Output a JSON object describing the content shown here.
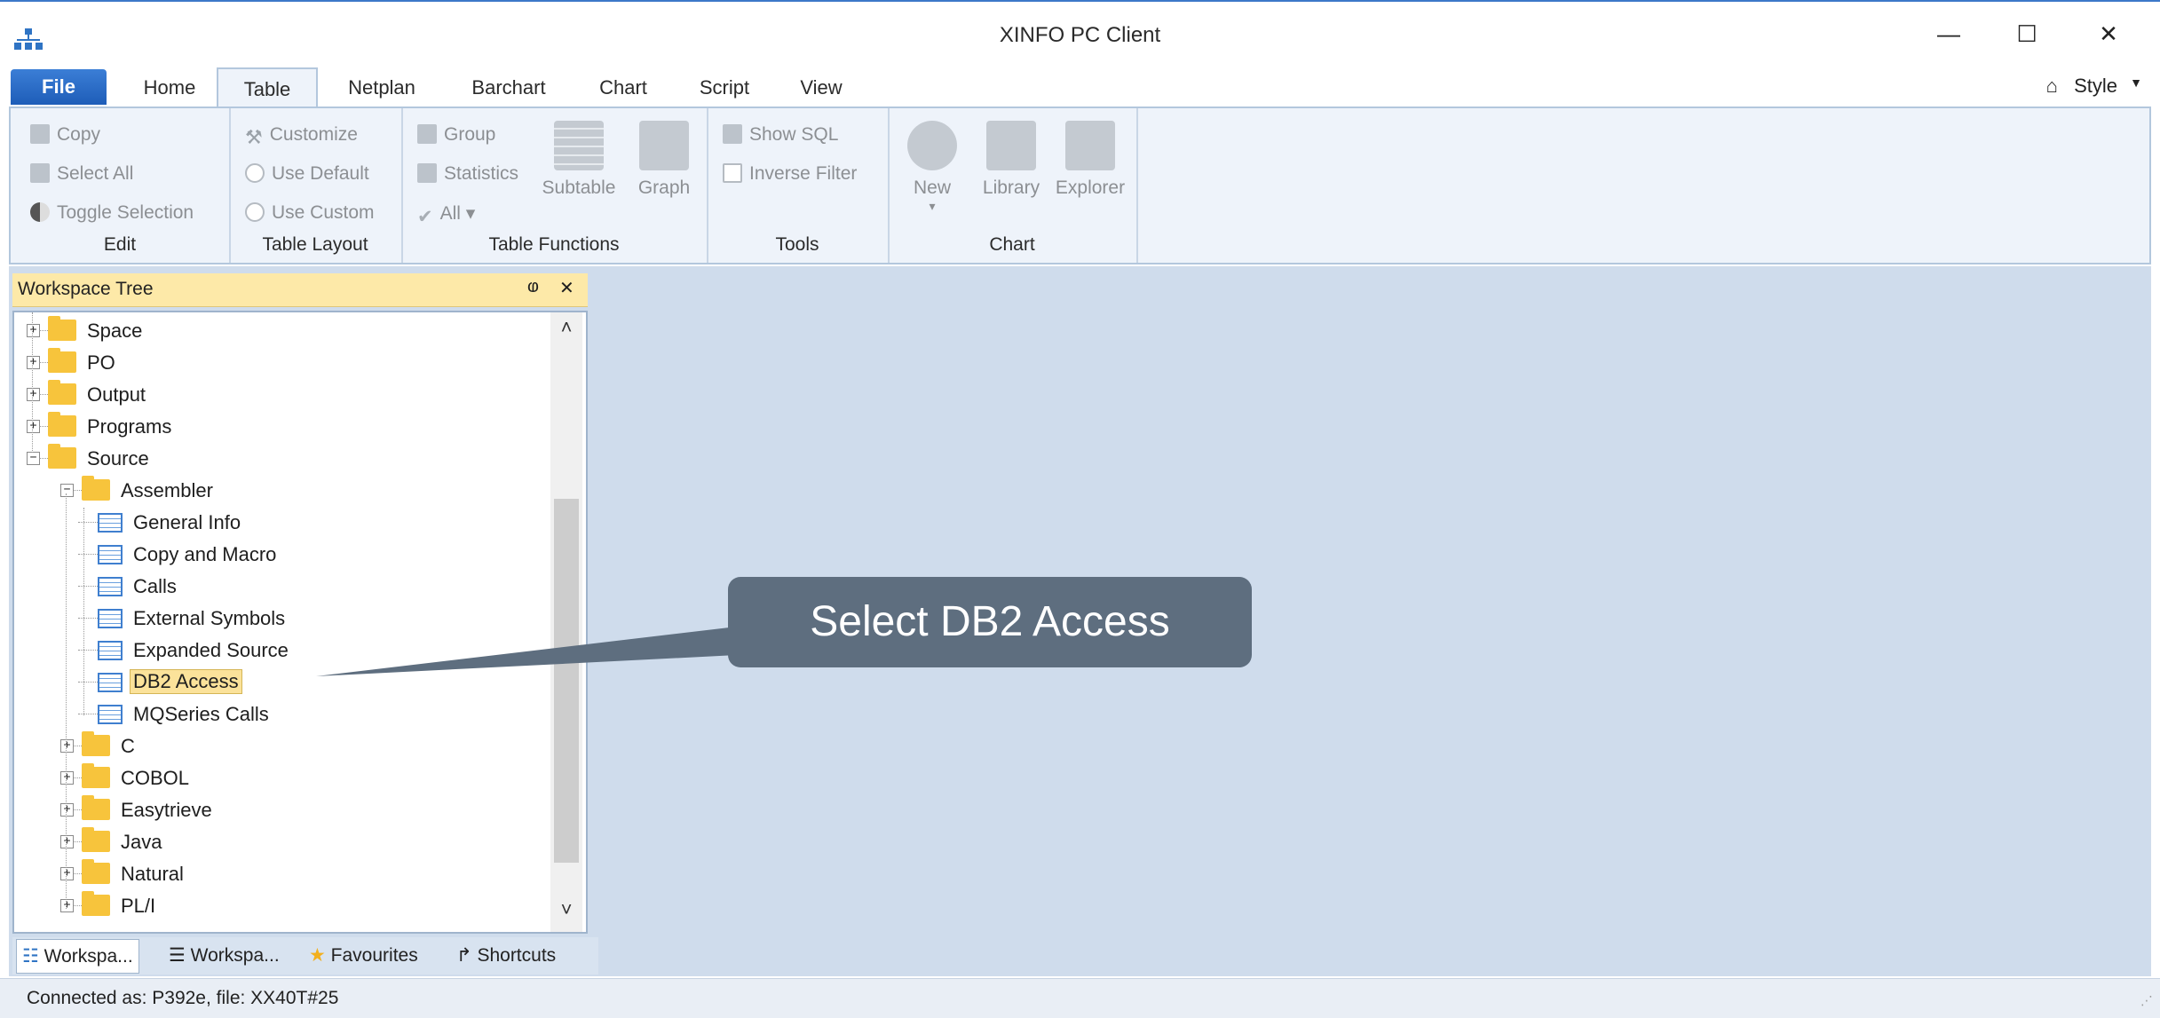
{
  "window": {
    "title": "XINFO PC Client",
    "minimize": "—",
    "maximize": "☐",
    "close": "✕"
  },
  "tabs": [
    "File",
    "Home",
    "Table",
    "Netplan",
    "Barchart",
    "Chart",
    "Script",
    "View"
  ],
  "style_label": "Style",
  "ribbon": {
    "edit": {
      "label": "Edit",
      "copy": "Copy",
      "select_all": "Select All",
      "toggle": "Toggle Selection"
    },
    "layout": {
      "label": "Table Layout",
      "customize": "Customize",
      "use_default": "Use Default",
      "use_custom": "Use Custom"
    },
    "functions": {
      "label": "Table Functions",
      "group": "Group",
      "statistics": "Statistics",
      "all": "All ▾",
      "subtable": "Subtable",
      "graph": "Graph"
    },
    "tools": {
      "label": "Tools",
      "show_sql": "Show SQL",
      "inverse_filter": "Inverse Filter"
    },
    "chart": {
      "label": "Chart",
      "new": "New",
      "new_arrow": "▾",
      "library": "Library",
      "explorer": "Explorer"
    }
  },
  "panel": {
    "title": "Workspace Tree",
    "pin": "ⱷ",
    "close": "✕"
  },
  "tree": [
    {
      "label": "Space",
      "type": "folder",
      "level": 0,
      "exp": "+"
    },
    {
      "label": "PO",
      "type": "folder",
      "level": 0,
      "exp": "+"
    },
    {
      "label": "Output",
      "type": "folder",
      "level": 0,
      "exp": "+"
    },
    {
      "label": "Programs",
      "type": "folder",
      "level": 0,
      "exp": "+"
    },
    {
      "label": "Source",
      "type": "folder",
      "level": 0,
      "exp": "−"
    },
    {
      "label": "Assembler",
      "type": "folder",
      "level": 1,
      "exp": "−"
    },
    {
      "label": "General Info",
      "type": "table",
      "level": 2
    },
    {
      "label": "Copy and Macro",
      "type": "table",
      "level": 2
    },
    {
      "label": "Calls",
      "type": "table",
      "level": 2
    },
    {
      "label": "External Symbols",
      "type": "table",
      "level": 2
    },
    {
      "label": "Expanded Source",
      "type": "table",
      "level": 2
    },
    {
      "label": "DB2 Access",
      "type": "table",
      "level": 2,
      "selected": true
    },
    {
      "label": "MQSeries Calls",
      "type": "table",
      "level": 2
    },
    {
      "label": "C",
      "type": "folder",
      "level": 1,
      "exp": "+"
    },
    {
      "label": "COBOL",
      "type": "folder",
      "level": 1,
      "exp": "+"
    },
    {
      "label": "Easytrieve",
      "type": "folder",
      "level": 1,
      "exp": "+"
    },
    {
      "label": "Java",
      "type": "folder",
      "level": 1,
      "exp": "+"
    },
    {
      "label": "Natural",
      "type": "folder",
      "level": 1,
      "exp": "+"
    },
    {
      "label": "PL/I",
      "type": "folder",
      "level": 1,
      "exp": "+"
    }
  ],
  "bottom_tabs": [
    "Workspa...",
    "Workspa...",
    "Favourites",
    "Shortcuts"
  ],
  "status": "Connected as: P392e, file: XX40T#25",
  "callout": "Select DB2 Access",
  "scroll": {
    "up": "˄",
    "down": "˅"
  }
}
